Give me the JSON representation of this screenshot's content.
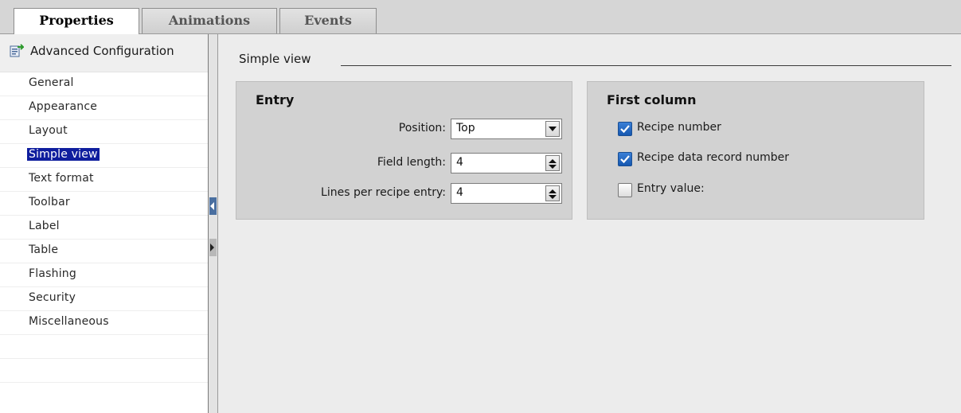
{
  "tabs": [
    {
      "label": "Properties",
      "active": true
    },
    {
      "label": "Animations",
      "active": false
    },
    {
      "label": "Events",
      "active": false
    }
  ],
  "nav": {
    "header": {
      "label": "Advanced Configuration",
      "icon": "configuration-icon"
    },
    "items": [
      {
        "label": "General"
      },
      {
        "label": "Appearance"
      },
      {
        "label": "Layout"
      },
      {
        "label": "Simple view",
        "selected": true
      },
      {
        "label": "Text format"
      },
      {
        "label": "Toolbar"
      },
      {
        "label": "Label"
      },
      {
        "label": "Table"
      },
      {
        "label": "Flashing"
      },
      {
        "label": "Security"
      },
      {
        "label": "Miscellaneous"
      }
    ]
  },
  "main": {
    "section_title": "Simple view",
    "entry": {
      "title": "Entry",
      "position_label": "Position:",
      "position_value": "Top",
      "field_length_label": "Field length:",
      "field_length_value": "4",
      "lines_label": "Lines per recipe entry:",
      "lines_value": "4"
    },
    "first_column": {
      "title": "First column",
      "recipe_number": {
        "label": "Recipe number",
        "checked": true
      },
      "recipe_record": {
        "label": "Recipe data record number",
        "checked": true
      },
      "entry_value": {
        "label": "Entry value:",
        "checked": false
      }
    }
  },
  "colors": {
    "selection": "#0f1e9e",
    "panel_bg": "#ececec",
    "group_bg": "#d2d2d2",
    "checkbox_checked": "#1f63c0"
  }
}
